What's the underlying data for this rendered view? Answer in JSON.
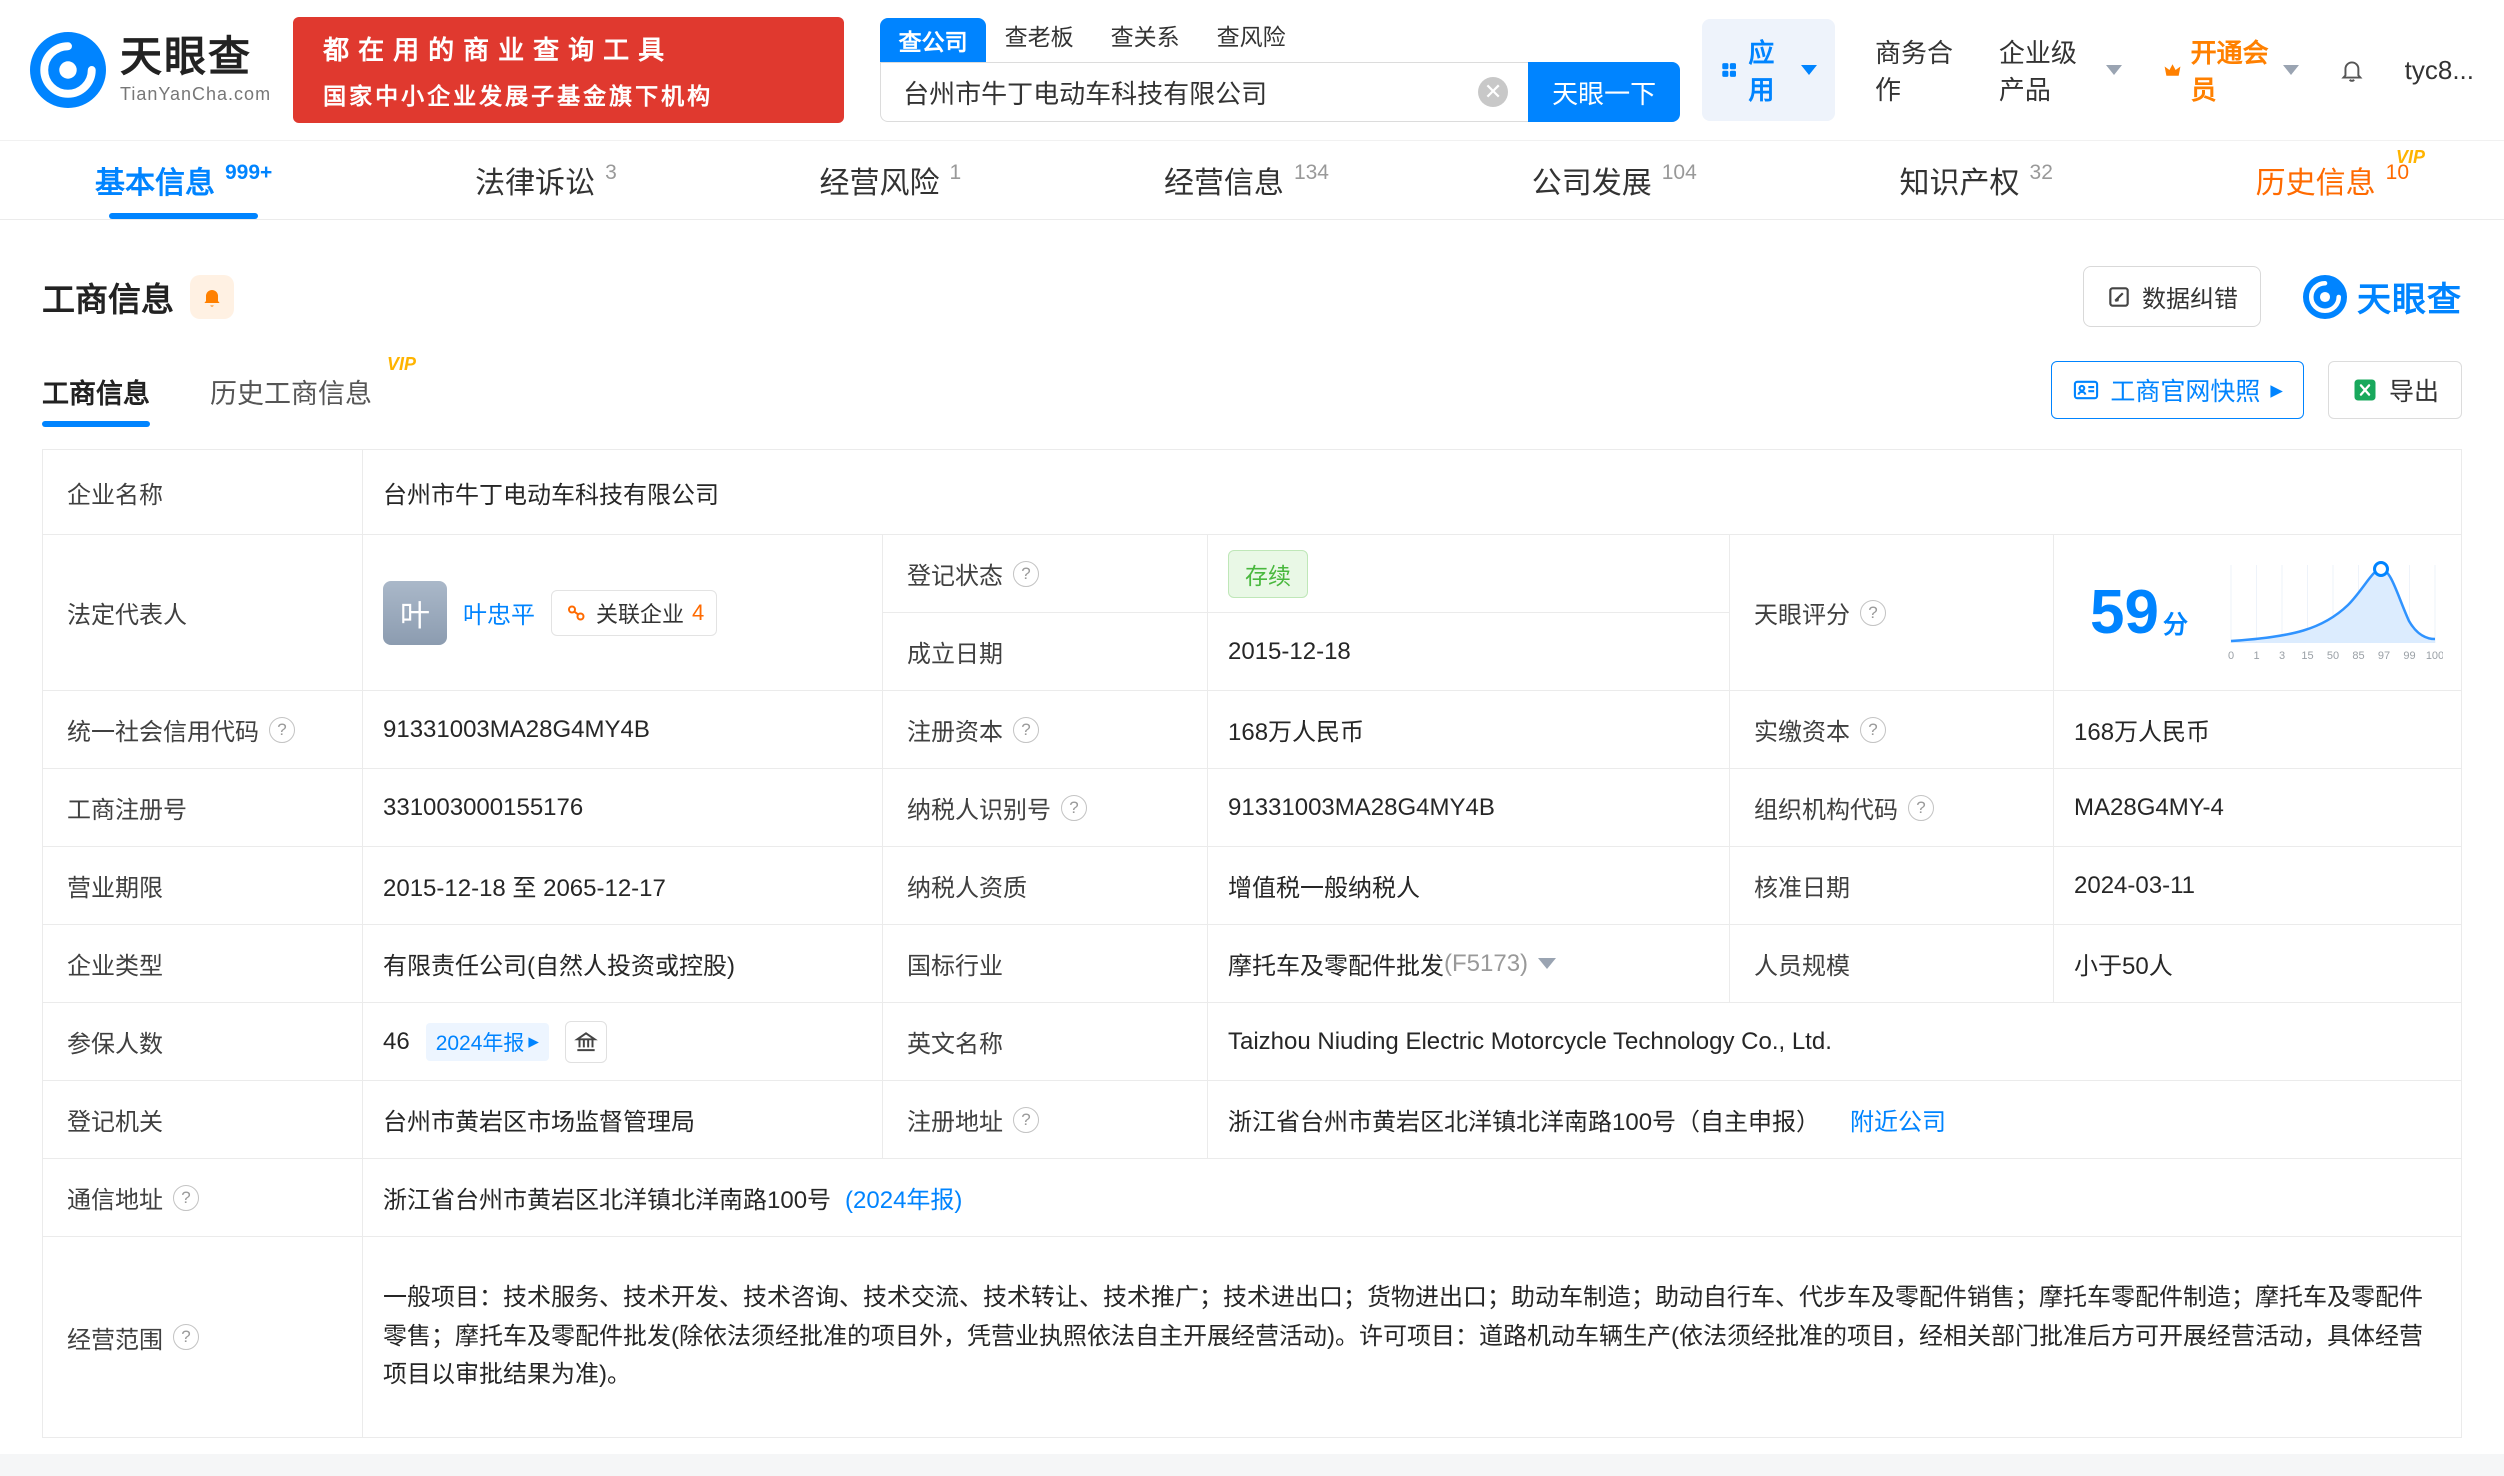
{
  "header": {
    "logo_cn": "天眼查",
    "logo_en": "TianYanCha.com",
    "banner_line1": "都在用的商业查询工具",
    "banner_line2": "国家中小企业发展子基金旗下机构",
    "search_tabs": [
      {
        "label": "查公司"
      },
      {
        "label": "查老板"
      },
      {
        "label": "查关系"
      },
      {
        "label": "查风险"
      }
    ],
    "search_value": "台州市牛丁电动车科技有限公司",
    "search_button": "天眼一下",
    "apps_label": "应用",
    "cooperation_label": "商务合作",
    "enterprise_label": "企业级产品",
    "vip_label": "开通会员",
    "username": "tyc8..."
  },
  "nav_tabs": [
    {
      "label": "基本信息",
      "count": "999+"
    },
    {
      "label": "法律诉讼",
      "count": "3"
    },
    {
      "label": "经营风险",
      "count": "1"
    },
    {
      "label": "经营信息",
      "count": "134"
    },
    {
      "label": "公司发展",
      "count": "104"
    },
    {
      "label": "知识产权",
      "count": "32"
    },
    {
      "label": "历史信息",
      "count": "10",
      "vip": "VIP"
    }
  ],
  "section": {
    "title": "工商信息",
    "data_correction": "数据纠错",
    "brand": "天眼查",
    "subtab_current": "工商信息",
    "subtab_history": "历史工商信息",
    "subtab_history_vip": "VIP",
    "snapshot_button": "工商官网快照",
    "export_button": "导出"
  },
  "table": {
    "company_name": {
      "label": "企业名称",
      "value": "台州市牛丁电动车科技有限公司"
    },
    "legal_rep": {
      "label": "法定代表人",
      "avatar": "叶",
      "name": "叶忠平",
      "related_label": "关联企业",
      "related_count": "4"
    },
    "reg_status": {
      "label": "登记状态",
      "value": "存续"
    },
    "establish_date": {
      "label": "成立日期",
      "value": "2015-12-18"
    },
    "score": {
      "label": "天眼评分",
      "value": "59",
      "unit": "分",
      "axis": [
        "0",
        "1",
        "3",
        "15",
        "50",
        "85",
        "97",
        "99",
        "100"
      ]
    },
    "credit_code": {
      "label": "统一社会信用代码",
      "value": "91331003MA28G4MY4B"
    },
    "reg_capital": {
      "label": "注册资本",
      "value": "168万人民币"
    },
    "paid_capital": {
      "label": "实缴资本",
      "value": "168万人民币"
    },
    "reg_number": {
      "label": "工商注册号",
      "value": "331003000155176"
    },
    "taxpayer_id": {
      "label": "纳税人识别号",
      "value": "91331003MA28G4MY4B"
    },
    "org_code": {
      "label": "组织机构代码",
      "value": "MA28G4MY-4"
    },
    "business_term": {
      "label": "营业期限",
      "value": "2015-12-18 至 2065-12-17"
    },
    "taxpayer_quality": {
      "label": "纳税人资质",
      "value": "增值税一般纳税人"
    },
    "approval_date": {
      "label": "核准日期",
      "value": "2024-03-11"
    },
    "company_type": {
      "label": "企业类型",
      "value": "有限责任公司(自然人投资或控股)"
    },
    "industry": {
      "label": "国标行业",
      "value": "摩托车及零配件批发",
      "code": "(F5173)"
    },
    "staff_size": {
      "label": "人员规模",
      "value": "小于50人"
    },
    "insured": {
      "label": "参保人数",
      "value": "46",
      "report_tag": "2024年报"
    },
    "english_name": {
      "label": "英文名称",
      "value": "Taizhou Niuding Electric Motorcycle Technology Co., Ltd."
    },
    "reg_authority": {
      "label": "登记机关",
      "value": "台州市黄岩区市场监督管理局"
    },
    "reg_address": {
      "label": "注册地址",
      "value": "浙江省台州市黄岩区北洋镇北洋南路100号（自主申报）",
      "link": "附近公司"
    },
    "postal_address": {
      "label": "通信地址",
      "value": "浙江省台州市黄岩区北洋镇北洋南路100号",
      "link": "(2024年报)"
    },
    "business_scope": {
      "label": "经营范围",
      "value": "一般项目：技术服务、技术开发、技术咨询、技术交流、技术转让、技术推广；技术进出口；货物进出口；助动车制造；助动自行车、代步车及零配件销售；摩托车零配件制造；摩托车及零配件零售；摩托车及零配件批发(除依法须经批准的项目外，凭营业执照依法自主开展经营活动)。许可项目：道路机动车辆生产(依法须经批准的项目，经相关部门批准后方可开展经营活动，具体经营项目以审批结果为准)。"
    }
  },
  "colors": {
    "brand_blue": "#0084ff",
    "banner_red": "#e0392f",
    "vip_orange": "#ff8000",
    "status_green": "#49b83e"
  }
}
